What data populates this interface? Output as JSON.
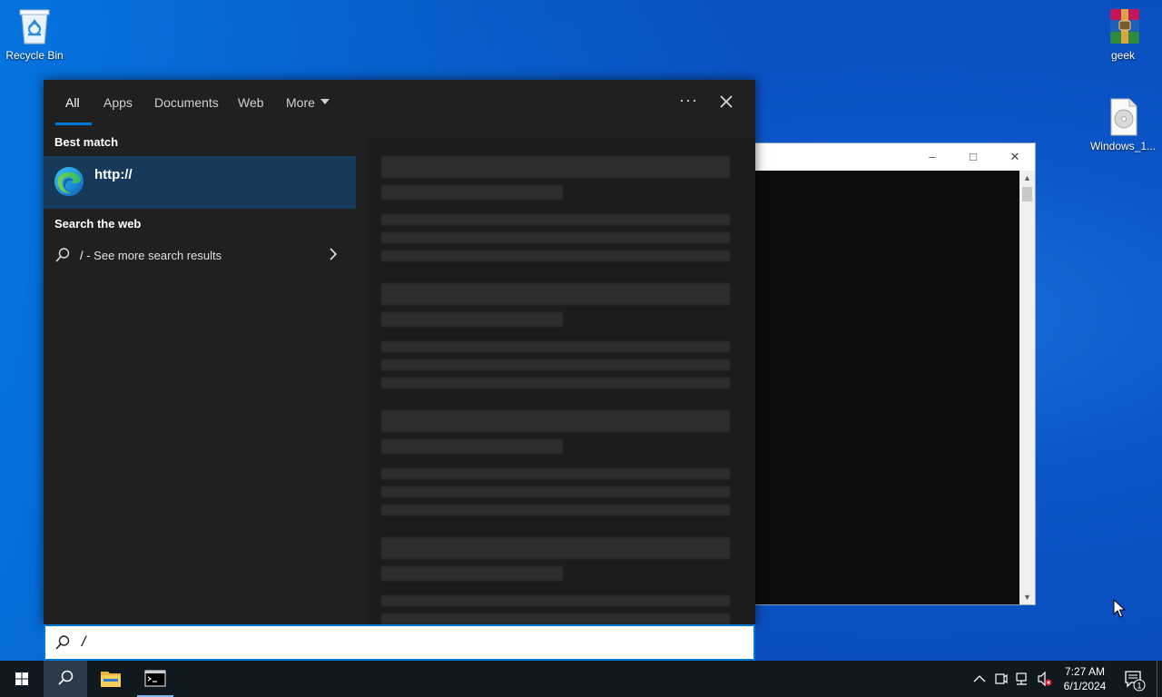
{
  "desktop": {
    "icons": [
      {
        "label": "Recycle Bin",
        "icon": "recycle-bin-icon"
      },
      {
        "label": "geek",
        "icon": "winrar-archive-icon"
      },
      {
        "label": "Windows_1...",
        "icon": "disc-image-file-icon"
      }
    ]
  },
  "console_window": {
    "minimize": "–",
    "maximize": "□",
    "close": "✕"
  },
  "search": {
    "tabs": [
      {
        "label": "All",
        "active": true
      },
      {
        "label": "Apps"
      },
      {
        "label": "Documents"
      },
      {
        "label": "Web"
      },
      {
        "label": "More"
      }
    ],
    "options_label": "···",
    "best_match_title": "Best match",
    "best_match_item": {
      "label": "http://",
      "icon": "edge-icon"
    },
    "web_title": "Search the web",
    "web_result": {
      "query": "/",
      "suffix": " - See more search results"
    },
    "query": "/"
  },
  "taskbar": {
    "items": [
      "start-icon",
      "search-icon",
      "file-explorer-icon",
      "command-prompt-icon"
    ],
    "time": "7:27 AM",
    "date": "6/1/2024",
    "notification_count": "1"
  },
  "colors": {
    "accent": "#0078d7",
    "panel_bg": "#202020",
    "selected_bg": "#173a5b",
    "taskbar_bg": "#101820"
  }
}
